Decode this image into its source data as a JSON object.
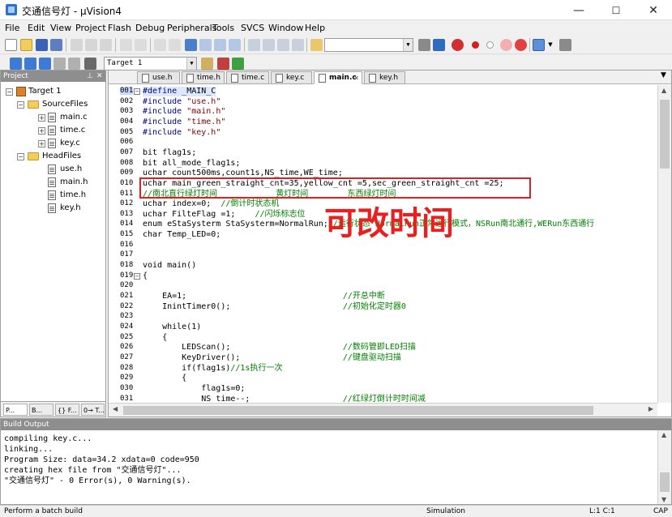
{
  "window": {
    "title": "交通信号灯 - µVision4",
    "minimize": "—",
    "maximize": "☐",
    "close": "✕"
  },
  "menu": [
    "File",
    "Edit",
    "View",
    "Project",
    "Flash",
    "Debug",
    "Peripherals",
    "Tools",
    "SVCS",
    "Window",
    "Help"
  ],
  "toolbar": {
    "target_select": "Target 1"
  },
  "project_panel": {
    "title": "Project",
    "pin": "⊥",
    "close": "✕",
    "tree": [
      {
        "label": "Target 1",
        "kind": "target",
        "level": 0,
        "expander": "−"
      },
      {
        "label": "SourceFiles",
        "kind": "folder",
        "level": 1,
        "expander": "−"
      },
      {
        "label": "main.c",
        "kind": "file",
        "level": 2,
        "expander": "+"
      },
      {
        "label": "time.c",
        "kind": "file",
        "level": 2,
        "expander": "+"
      },
      {
        "label": "key.c",
        "kind": "file",
        "level": 2,
        "expander": "+"
      },
      {
        "label": "HeadFiles",
        "kind": "folder",
        "level": 1,
        "expander": "−"
      },
      {
        "label": "use.h",
        "kind": "file",
        "level": 2,
        "expander": ""
      },
      {
        "label": "main.h",
        "kind": "file",
        "level": 2,
        "expander": ""
      },
      {
        "label": "time.h",
        "kind": "file",
        "level": 2,
        "expander": ""
      },
      {
        "label": "key.h",
        "kind": "file",
        "level": 2,
        "expander": ""
      }
    ],
    "bottom_tabs": [
      "P...",
      "B...",
      "{} F...",
      "0→ T..."
    ]
  },
  "editor": {
    "tabs": [
      {
        "label": "use.h",
        "active": false
      },
      {
        "label": "time.h",
        "active": false
      },
      {
        "label": "time.c",
        "active": false
      },
      {
        "label": "key.c",
        "active": false
      },
      {
        "label": "main.c",
        "active": true
      },
      {
        "label": "key.h",
        "active": false
      }
    ],
    "tab_close": "✕",
    "lines": [
      {
        "n": "001",
        "fold": "−",
        "segs": [
          [
            "kw",
            "#define"
          ],
          [
            "",
            " _MAIN_C"
          ]
        ]
      },
      {
        "n": "002",
        "segs": [
          [
            "kw",
            "#include"
          ],
          [
            "",
            " "
          ],
          [
            "str",
            "\"use.h\""
          ]
        ]
      },
      {
        "n": "003",
        "segs": [
          [
            "kw",
            "#include"
          ],
          [
            "",
            " "
          ],
          [
            "str",
            "\"main.h\""
          ]
        ]
      },
      {
        "n": "004",
        "segs": [
          [
            "kw",
            "#include"
          ],
          [
            "",
            " "
          ],
          [
            "str",
            "\"time.h\""
          ]
        ]
      },
      {
        "n": "005",
        "segs": [
          [
            "kw",
            "#include"
          ],
          [
            "",
            " "
          ],
          [
            "str",
            "\"key.h\""
          ]
        ]
      },
      {
        "n": "006",
        "segs": [
          [
            "",
            ""
          ]
        ]
      },
      {
        "n": "007",
        "segs": [
          [
            "",
            "bit flag1s;"
          ]
        ]
      },
      {
        "n": "008",
        "segs": [
          [
            "",
            "bit all_mode_flag1s;"
          ]
        ]
      },
      {
        "n": "009",
        "segs": [
          [
            "",
            "uchar count500ms,count1s,NS_time,WE_time;"
          ]
        ]
      },
      {
        "n": "010",
        "segs": [
          [
            "",
            "uchar main_green_straight_cnt=35,yellow_cnt =5,sec_green_straight_cnt =25;"
          ]
        ]
      },
      {
        "n": "011",
        "segs": [
          [
            "cm",
            "//南北直行绿灯时间            黄灯时间        东西绿灯时间"
          ]
        ]
      },
      {
        "n": "012",
        "segs": [
          [
            "",
            "uchar index=0;  "
          ],
          [
            "cm",
            "//倒计时状态机"
          ]
        ]
      },
      {
        "n": "013",
        "segs": [
          [
            "",
            "uchar FilteFlag =1;    "
          ],
          [
            "cm",
            "//闪烁标志位"
          ]
        ]
      },
      {
        "n": "014",
        "segs": [
          [
            "",
            "enum eStaSysterm StaSysterm=NormalRun;"
          ],
          [
            "cm",
            "//运行状态 NormalRun正常运行模式，NSRun南北通行,WERun东西通行"
          ]
        ]
      },
      {
        "n": "015",
        "segs": [
          [
            "",
            "char Temp_LED=0;"
          ]
        ]
      },
      {
        "n": "016",
        "segs": [
          [
            "",
            ""
          ]
        ]
      },
      {
        "n": "017",
        "segs": [
          [
            "",
            ""
          ]
        ]
      },
      {
        "n": "018",
        "segs": [
          [
            "",
            "void main()"
          ]
        ]
      },
      {
        "n": "019",
        "fold": "−",
        "segs": [
          [
            "",
            "{"
          ]
        ]
      },
      {
        "n": "020",
        "segs": [
          [
            "",
            ""
          ]
        ]
      },
      {
        "n": "021",
        "segs": [
          [
            "",
            "    EA=1;                                "
          ],
          [
            "cm",
            "//开总中断"
          ]
        ]
      },
      {
        "n": "022",
        "segs": [
          [
            "",
            "    InintTimer0();                       "
          ],
          [
            "cm",
            "//初始化定时器0"
          ]
        ]
      },
      {
        "n": "023",
        "segs": [
          [
            "",
            ""
          ]
        ]
      },
      {
        "n": "024",
        "segs": [
          [
            "",
            "    while(1)"
          ]
        ]
      },
      {
        "n": "025",
        "segs": [
          [
            "",
            "    {"
          ]
        ]
      },
      {
        "n": "026",
        "segs": [
          [
            "",
            "        LEDScan();                       "
          ],
          [
            "cm",
            "//数码管即LED扫描"
          ]
        ]
      },
      {
        "n": "027",
        "segs": [
          [
            "",
            "        KeyDriver();                     "
          ],
          [
            "cm",
            "//键盘驱动扫描"
          ]
        ]
      },
      {
        "n": "028",
        "segs": [
          [
            "",
            "        if(flag1s)"
          ],
          [
            "cm",
            "//1s执行一次"
          ]
        ]
      },
      {
        "n": "029",
        "segs": [
          [
            "",
            "        {"
          ]
        ]
      },
      {
        "n": "030",
        "segs": [
          [
            "",
            "            flag1s=0;"
          ]
        ]
      },
      {
        "n": "031",
        "segs": [
          [
            "",
            "            NS_time--;                   "
          ],
          [
            "cm",
            "//红绿灯倒计时时间减"
          ]
        ]
      }
    ]
  },
  "annotation": {
    "text": "可改时间",
    "color": "#e82020"
  },
  "build_output": {
    "title": "Build Output",
    "lines": [
      "compiling key.c...",
      "linking...",
      "Program Size: data=34.2 xdata=0 code=950",
      "creating hex file from \"交通信号灯\"...",
      "\"交通信号灯\" - 0 Error(s), 0 Warning(s)."
    ]
  },
  "status": {
    "message": "Perform a batch build",
    "mode": "Simulation",
    "position": "L:1 C:1",
    "caps": "CAP"
  }
}
